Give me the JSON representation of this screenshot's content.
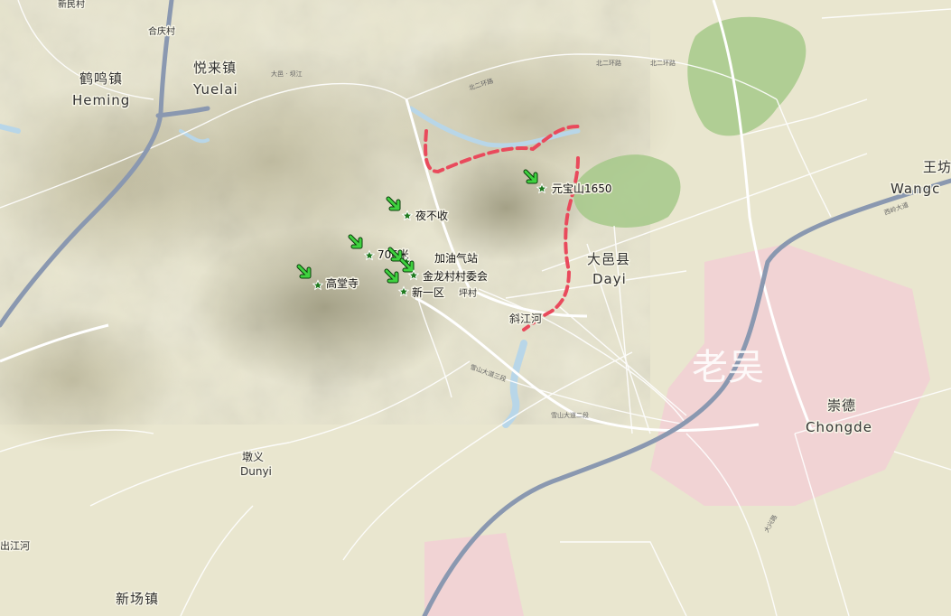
{
  "places": {
    "heming_cn": "鹤鸣镇",
    "heming_en": "Heming",
    "yuelai_cn": "悦来镇",
    "yuelai_en": "Yuelai",
    "dayi_cn": "大邑县",
    "dayi_en": "Dayi",
    "chongde_cn": "崇德",
    "chongde_en": "Chongde",
    "dunyi_cn": "墩义",
    "dunyi_en": "Dunyi",
    "xinchang_cn": "新场镇",
    "wang_cn": "王坊",
    "wang_en": "Wangc",
    "xinmin": "新民村",
    "heqing": "合庆村",
    "ping": "坪村",
    "xiejiang": "斜江河",
    "chujiang": "出江河"
  },
  "roads": {
    "n_ring_1": "北二环路",
    "n_ring_2": "北二环路",
    "n_ring_3": "北二环路",
    "dayi_rd": "大邑 · 坝江",
    "xueshan_3": "雪山大道三段",
    "xueshan_2": "雪山大道二段",
    "xinmin_rd": "西岭大道",
    "datang_rd": "大兴路"
  },
  "pois": {
    "yuanbao": "元宝山1650",
    "yebushou": "夜不收",
    "m706": "706米",
    "jiayou": "加油气站",
    "jinlong": "金龙村村委会",
    "xinyiqu": "新一区",
    "gaotang": "高堂寺"
  },
  "watermark": "老吴",
  "colors": {
    "background": "#e9e6cf",
    "urban": "#f2d0d4",
    "forest": "#a6c98a",
    "water": "#b8d6e8",
    "road": "#ffffff",
    "highway": "#8a98b0",
    "route": "#e94a5c",
    "poi_star": "#1f7a1f",
    "poi_arrow": "#3fd13f"
  },
  "markers": {
    "poi_icon": "green-star-icon",
    "arrow_icon": "green-arrow-icon"
  }
}
